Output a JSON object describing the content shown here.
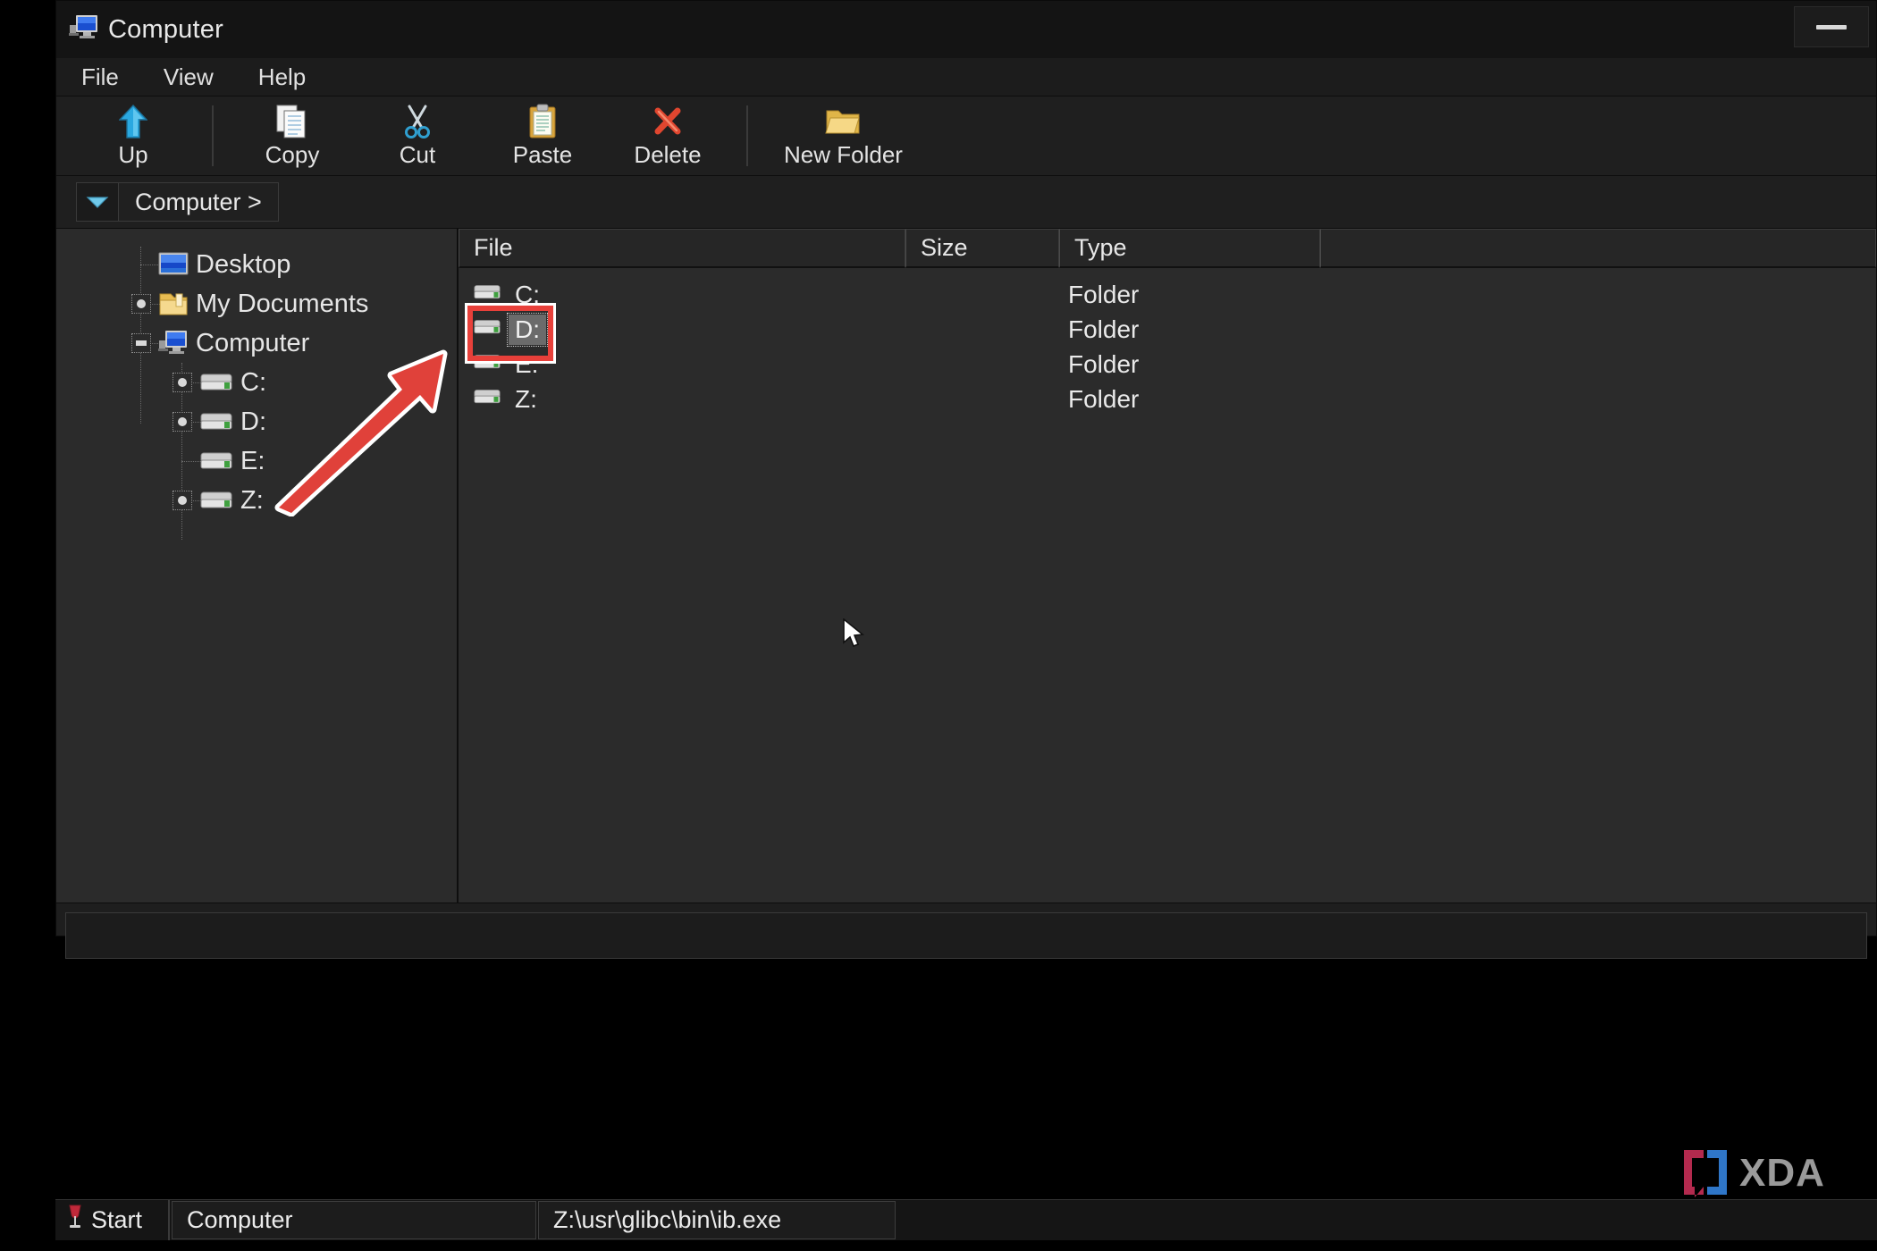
{
  "window": {
    "title": "Computer",
    "title_icon": "computer-monitor-icon",
    "minimize_label": "Minimize"
  },
  "menubar": {
    "items": [
      {
        "label": "File"
      },
      {
        "label": "View"
      },
      {
        "label": "Help"
      }
    ]
  },
  "toolbar": {
    "buttons": [
      {
        "label": "Up",
        "icon": "up-arrow-icon"
      },
      {
        "label": "Copy",
        "icon": "copy-pages-icon"
      },
      {
        "label": "Cut",
        "icon": "scissors-icon"
      },
      {
        "label": "Paste",
        "icon": "clipboard-icon"
      },
      {
        "label": "Delete",
        "icon": "red-x-icon"
      },
      {
        "label": "New Folder",
        "icon": "new-folder-icon"
      }
    ]
  },
  "address_bar": {
    "dropdown_icon": "chevron-down-icon",
    "path": "Computer >"
  },
  "tree": {
    "items": [
      {
        "label": "Desktop",
        "icon": "desktop-icon",
        "expander": "none",
        "depth": 1
      },
      {
        "label": "My Documents",
        "icon": "folder-icon",
        "expander": "plus",
        "depth": 1
      },
      {
        "label": "Computer",
        "icon": "computer-icon",
        "expander": "minus",
        "depth": 1
      },
      {
        "label": "C:",
        "icon": "drive-icon",
        "expander": "plus",
        "depth": 2
      },
      {
        "label": "D:",
        "icon": "drive-icon",
        "expander": "plus",
        "depth": 2
      },
      {
        "label": "E:",
        "icon": "drive-icon",
        "expander": "none",
        "depth": 2
      },
      {
        "label": "Z:",
        "icon": "drive-icon",
        "expander": "plus",
        "depth": 2
      }
    ]
  },
  "file_list": {
    "columns": [
      {
        "label": "File"
      },
      {
        "label": "Size"
      },
      {
        "label": "Type"
      },
      {
        "label": ""
      }
    ],
    "rows": [
      {
        "name": "C:",
        "size": "",
        "type": "Folder",
        "icon": "drive-icon",
        "selected": false
      },
      {
        "name": "D:",
        "size": "",
        "type": "Folder",
        "icon": "drive-icon",
        "selected": true
      },
      {
        "name": "E:",
        "size": "",
        "type": "Folder",
        "icon": "drive-icon",
        "selected": false
      },
      {
        "name": "Z:",
        "size": "",
        "type": "Folder",
        "icon": "drive-icon",
        "selected": false
      }
    ]
  },
  "status_bar": {
    "text": ""
  },
  "taskbar": {
    "start_label": "Start",
    "start_icon": "wine-glass-icon",
    "buttons": [
      {
        "label": "Computer"
      },
      {
        "label": "Z:\\usr\\glibc\\bin\\ib.exe"
      }
    ]
  },
  "annotations": {
    "highlight_target": "D:",
    "highlight_color": "#e8403a",
    "arrow": "red-arrow-pointing-to-d-drive",
    "cursor": "mouse-pointer"
  },
  "watermark": {
    "text": "XDA"
  }
}
